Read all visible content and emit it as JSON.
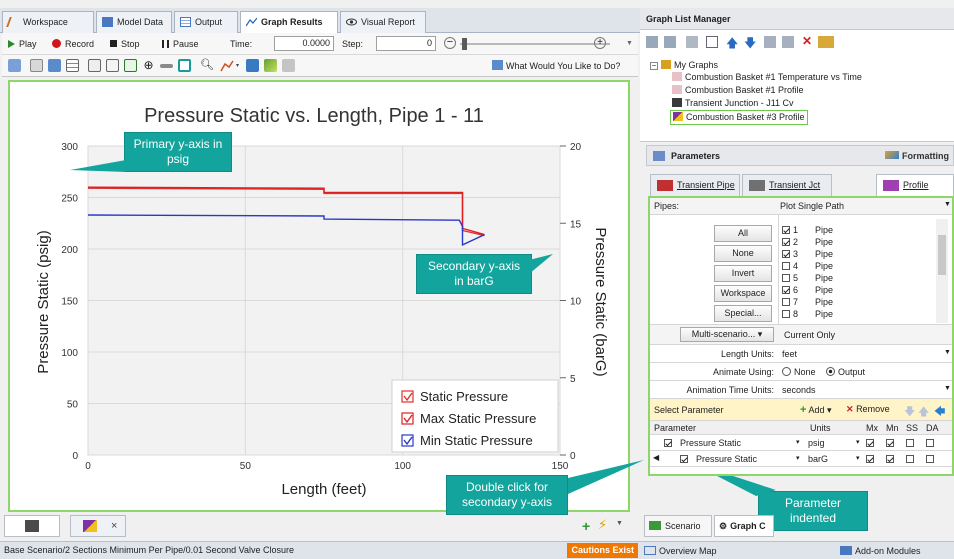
{
  "tabs": [
    {
      "label": "Workspace",
      "active": false
    },
    {
      "label": "Model Data",
      "active": false
    },
    {
      "label": "Output",
      "active": false
    },
    {
      "label": "Graph Results",
      "active": true
    },
    {
      "label": "Visual Report",
      "active": false
    }
  ],
  "playback": {
    "play_label": "Play",
    "record_label": "Record",
    "stop_label": "Stop",
    "pause_label": "Pause",
    "time_label": "Time:",
    "time_value": "0.0000",
    "step_label": "Step:",
    "step_value": "0"
  },
  "toolbar": {
    "help_label": "What Would You Like to Do?"
  },
  "chart_data": {
    "type": "line",
    "title": "Pressure Static vs. Length, Pipe 1 - 11",
    "xlabel": "Length (feet)",
    "ylabel": "Pressure Static (psig)",
    "y2label": "Pressure Static (barG)",
    "xlim": [
      0,
      150
    ],
    "ylim": [
      0,
      300
    ],
    "y2lim": [
      0,
      20
    ],
    "xticks": [
      "0",
      "50",
      "100",
      "150"
    ],
    "yticks": [
      "0",
      "50",
      "100",
      "150",
      "200",
      "250",
      "300"
    ],
    "y2ticks": [
      "0",
      "5",
      "10",
      "15",
      "20"
    ],
    "grid": true,
    "legend_position": "bottom-right",
    "series": [
      {
        "name": "Static Pressure",
        "color": "#e03030",
        "x": [
          0,
          75,
          75,
          119,
          119,
          126
        ],
        "y": [
          259,
          258,
          254,
          254,
          218,
          213
        ]
      },
      {
        "name": "Max Static Pressure",
        "color": "#e02020",
        "x": [
          0,
          75,
          75,
          119,
          119,
          126
        ],
        "y": [
          260,
          259,
          255,
          255,
          220,
          214
        ]
      },
      {
        "name": "Min Static Pressure",
        "color": "#2838c8",
        "x": [
          0,
          75,
          75,
          118,
          119,
          119,
          126
        ],
        "y": [
          233,
          232,
          229,
          228,
          222,
          204,
          214
        ]
      }
    ]
  },
  "callouts": {
    "primary": "Primary y-axis in psig",
    "secondary": "Secondary y-axis in barG",
    "double_click": "Double click for secondary y-axis",
    "indented": "Parameter indented"
  },
  "bottom_tabs": {
    "close": "×"
  },
  "status": {
    "left": "Base Scenario/2 Sections Minimum Per Pipe/0.01 Second Valve Closure",
    "cautions": "Cautions Exist"
  },
  "graph_list": {
    "title": "Graph List Manager",
    "root": "My Graphs",
    "items": [
      "Combustion Basket #1 Temperature vs Time",
      "Combustion Basket #1 Profile",
      "Transient Junction - J11 Cv",
      "Combustion Basket #3 Profile"
    ]
  },
  "parameters": {
    "title": "Parameters",
    "formatting": "Formatting",
    "tabs": [
      "Transient Pipe",
      "Transient Jct",
      "Profile"
    ],
    "pipes_label": "Pipes:",
    "pipes_mode": "Plot Single Path",
    "buttons": [
      "All",
      "None",
      "Invert",
      "Workspace",
      "Special..."
    ],
    "pipe_list": [
      {
        "num": "1",
        "name": "Pipe",
        "checked": true
      },
      {
        "num": "2",
        "name": "Pipe",
        "checked": true
      },
      {
        "num": "3",
        "name": "Pipe",
        "checked": true
      },
      {
        "num": "4",
        "name": "Pipe",
        "checked": false
      },
      {
        "num": "5",
        "name": "Pipe",
        "checked": false
      },
      {
        "num": "6",
        "name": "Pipe",
        "checked": true
      },
      {
        "num": "7",
        "name": "Pipe",
        "checked": false
      },
      {
        "num": "8",
        "name": "Pipe",
        "checked": false
      }
    ],
    "multi_scenario": "Multi-scenario...",
    "current_only": "Current Only",
    "length_units_label": "Length Units:",
    "length_units": "feet",
    "animate_label": "Animate Using:",
    "animate_none": "None",
    "animate_output": "Output",
    "anim_time_label": "Animation Time Units:",
    "anim_time": "seconds",
    "select_param": "Select Parameter",
    "add": "Add",
    "remove": "Remove",
    "col_param": "Parameter",
    "col_units": "Units",
    "col_mx": "Mx",
    "col_mn": "Mn",
    "col_ss": "SS",
    "col_da": "DA",
    "rows": [
      {
        "param": "Pressure Static",
        "units": "psig"
      },
      {
        "param": "Pressure Static",
        "units": "barG"
      }
    ]
  },
  "right_bottom": {
    "scenario_tab": "Scenario",
    "graph_tab": "Graph C",
    "overview": "Overview Map",
    "addon": "Add-on Modules"
  }
}
